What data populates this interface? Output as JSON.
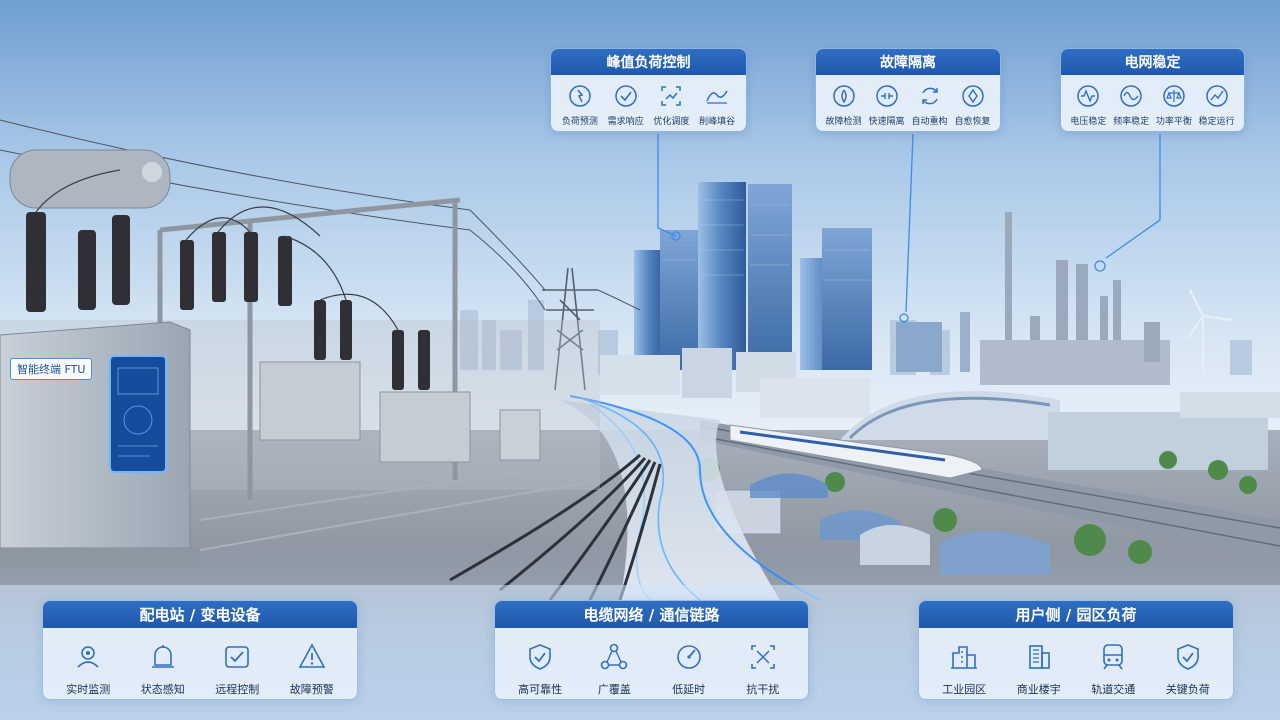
{
  "colors": {
    "panel_header": "#2563b8",
    "accent": "#3b8de8",
    "text_dark": "#1a2f55"
  },
  "top_panels": [
    {
      "title": "峰值负荷控制",
      "items": [
        {
          "label": "负荷预测",
          "icon": "load-forecast-icon"
        },
        {
          "label": "需求响应",
          "icon": "demand-response-icon"
        },
        {
          "label": "优化调度",
          "icon": "optimize-dispatch-icon"
        },
        {
          "label": "削峰填谷",
          "icon": "peak-shaving-icon"
        }
      ]
    },
    {
      "title": "故障隔离",
      "items": [
        {
          "label": "故障检测",
          "icon": "fault-detect-icon"
        },
        {
          "label": "快速隔离",
          "icon": "fast-isolate-icon"
        },
        {
          "label": "自动重构",
          "icon": "auto-reconfigure-icon"
        },
        {
          "label": "自愈恢复",
          "icon": "self-heal-icon"
        }
      ]
    },
    {
      "title": "电网稳定",
      "items": [
        {
          "label": "电压稳定",
          "icon": "voltage-stable-icon"
        },
        {
          "label": "频率稳定",
          "icon": "frequency-stable-icon"
        },
        {
          "label": "功率平衡",
          "icon": "power-balance-icon"
        },
        {
          "label": "稳定运行",
          "icon": "stable-run-icon"
        }
      ]
    }
  ],
  "ftu_label": "智能终端 FTU",
  "bottom_panels": [
    {
      "title": "配电站 / 变电设备",
      "items": [
        {
          "label": "实时监测",
          "icon": "realtime-monitor-icon"
        },
        {
          "label": "状态感知",
          "icon": "status-sense-icon"
        },
        {
          "label": "远程控制",
          "icon": "remote-control-icon"
        },
        {
          "label": "故障预警",
          "icon": "fault-warning-icon"
        }
      ]
    },
    {
      "title": "电缆网络 / 通信链路",
      "items": [
        {
          "label": "高可靠性",
          "icon": "shield-check-icon"
        },
        {
          "label": "广覆盖",
          "icon": "network-nodes-icon"
        },
        {
          "label": "低延时",
          "icon": "gauge-icon"
        },
        {
          "label": "抗干扰",
          "icon": "anti-interference-icon"
        }
      ]
    },
    {
      "title": "用户侧 / 园区负荷",
      "items": [
        {
          "label": "工业园区",
          "icon": "industrial-park-icon"
        },
        {
          "label": "商业楼宇",
          "icon": "commercial-building-icon"
        },
        {
          "label": "轨道交通",
          "icon": "metro-train-icon"
        },
        {
          "label": "关键负荷",
          "icon": "critical-load-shield-icon"
        }
      ]
    }
  ]
}
